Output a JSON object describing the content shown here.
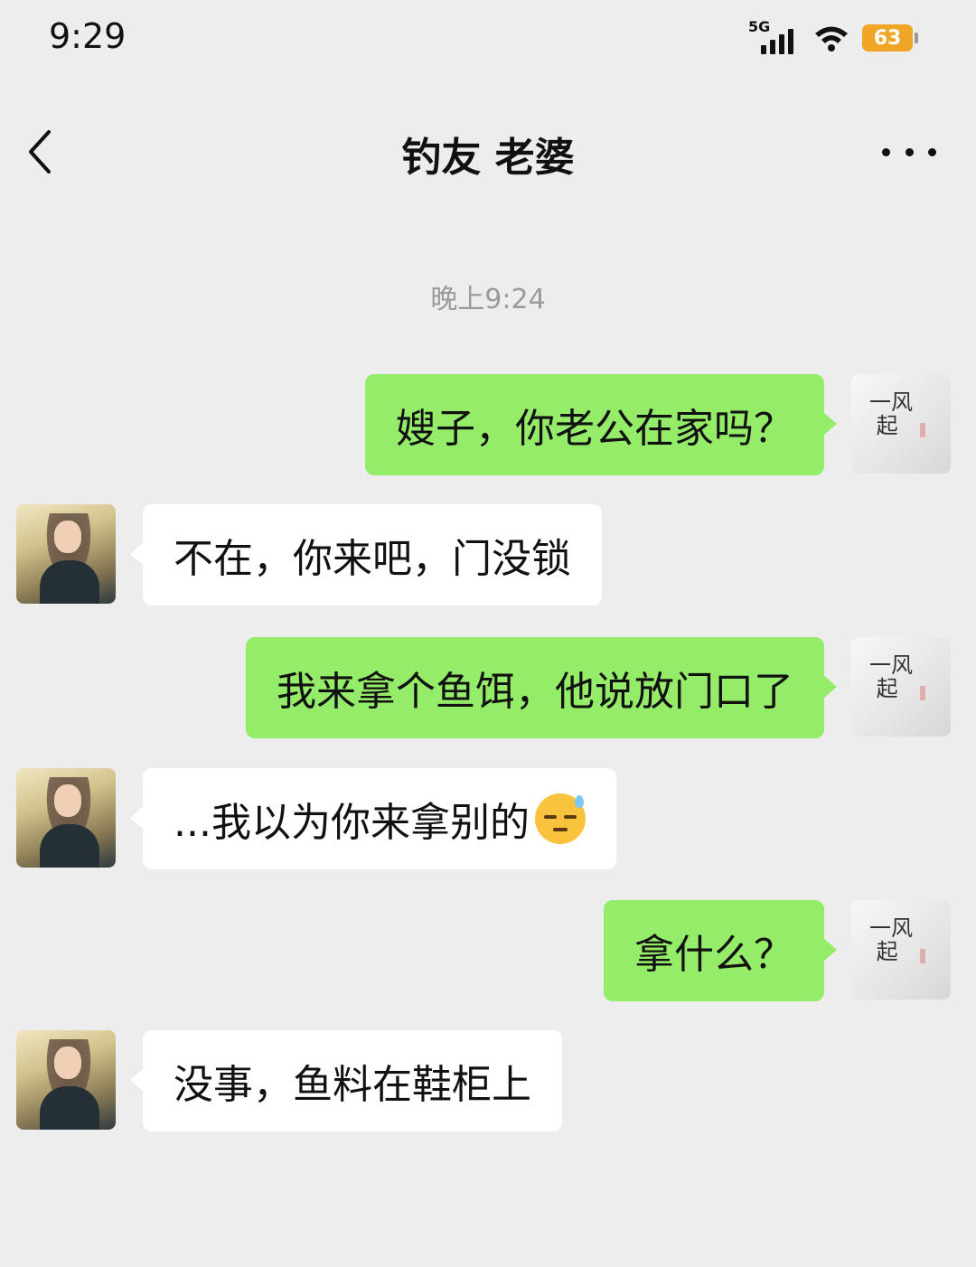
{
  "status_bar": {
    "time": "9:29",
    "network_label": "5G",
    "battery": "63"
  },
  "header": {
    "title": "钓友 老婆"
  },
  "chat": {
    "timestamp": "晚上9:24",
    "messages": [
      {
        "side": "right",
        "text": "嫂子，你老公在家吗？"
      },
      {
        "side": "left",
        "text": "不在，你来吧，门没锁"
      },
      {
        "side": "right",
        "text": "我来拿个鱼饵，他说放门口了"
      },
      {
        "side": "left",
        "text": "...我以为你来拿别的",
        "emoji": "sweat-smile-icon"
      },
      {
        "side": "right",
        "text": "拿什么？"
      },
      {
        "side": "left",
        "text": "没事，鱼料在鞋柜上"
      }
    ],
    "self_avatar_calligraphy": "一风\n起"
  },
  "colors": {
    "background": "#ededed",
    "bubble_self": "#95ec69",
    "bubble_other": "#ffffff",
    "battery": "#f0a526"
  }
}
